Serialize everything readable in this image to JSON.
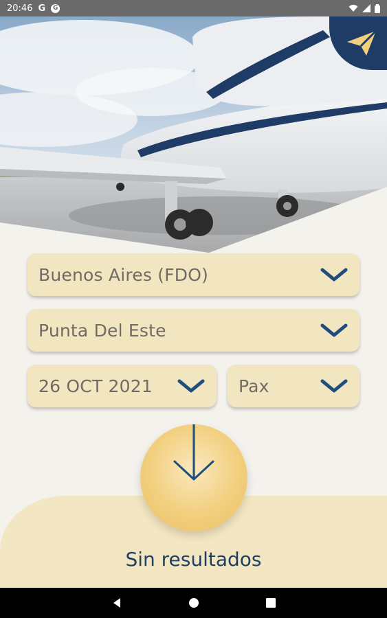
{
  "status_bar": {
    "time": "20:46",
    "icons": [
      "google-icon",
      "google-one-icon",
      "wifi-icon",
      "signal-icon",
      "battery-icon"
    ]
  },
  "hero": {
    "image": "private-jet-on-tarmac",
    "badge_icon": "paper-plane-icon"
  },
  "form": {
    "origin": {
      "value": "Buenos Aires (FDO)",
      "icon": "chevron-down-icon"
    },
    "destination": {
      "value": "Punta Del Este",
      "icon": "chevron-down-icon"
    },
    "date": {
      "value": "26 OCT 2021",
      "icon": "chevron-down-icon"
    },
    "passengers": {
      "value": "Pax",
      "icon": "chevron-down-icon"
    }
  },
  "search": {
    "icon": "arrow-down-icon"
  },
  "results": {
    "status": "Sin resultados"
  },
  "colors": {
    "navy": "#1e3c66",
    "cream": "#f2e6c1",
    "gold": "#f2cf7e",
    "background": "#f4f2ed"
  },
  "nav_bar": {
    "icons": [
      "back-icon",
      "home-icon",
      "recents-icon"
    ]
  }
}
